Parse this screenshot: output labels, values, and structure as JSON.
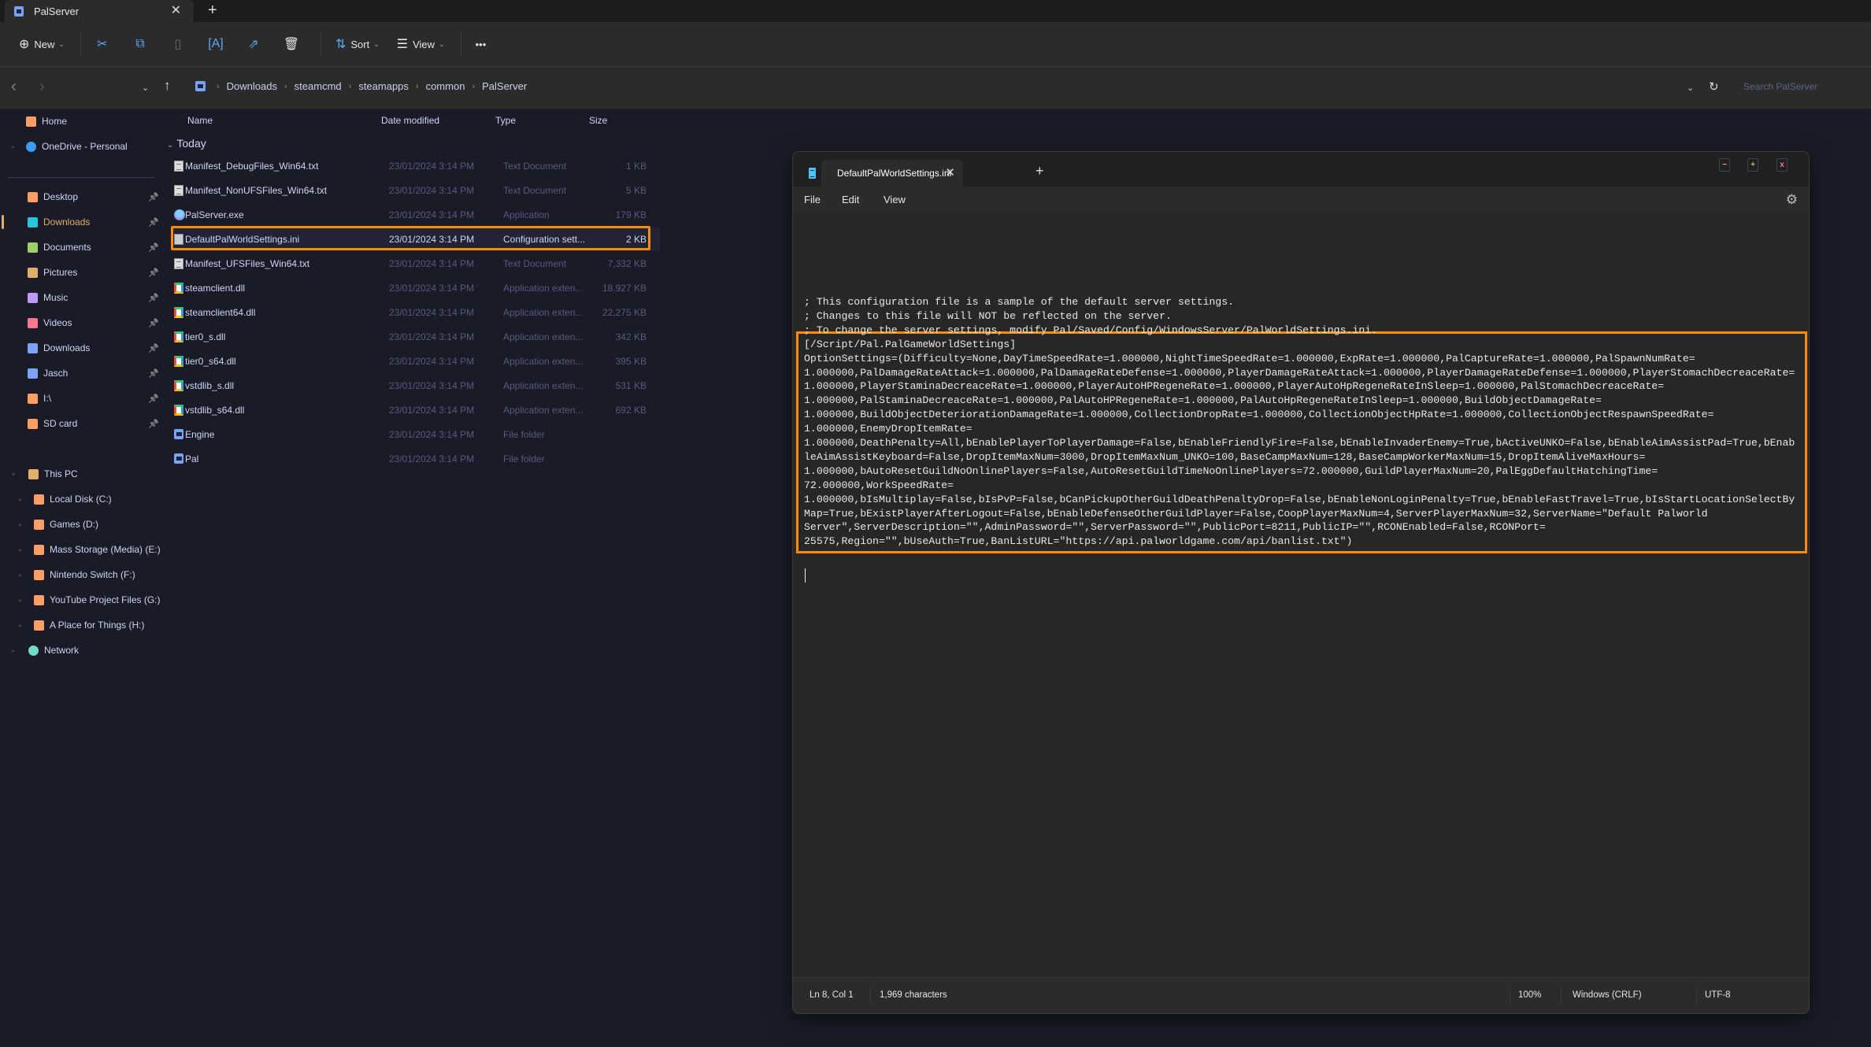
{
  "explorer": {
    "window_tab": {
      "title": "PalServer",
      "close": "✕",
      "new_tab": "+"
    },
    "toolbar": {
      "new_label": "New",
      "sort_label": "Sort",
      "view_label": "View",
      "more_label": "•••",
      "icons": [
        "cut-icon",
        "copy-icon",
        "paste-icon",
        "rename-icon",
        "share-icon",
        "delete-icon"
      ]
    },
    "breadcrumb": [
      "Downloads",
      "steamcmd",
      "steamapps",
      "common",
      "PalServer"
    ],
    "search_placeholder": "Search PalServer",
    "sidebar": {
      "top": [
        {
          "label": "Home",
          "icon": "home-icon",
          "color": "#ff9e64"
        },
        {
          "label": "OneDrive - Personal",
          "icon": "cloud-icon",
          "color": "#3b9cf0"
        }
      ],
      "quick_access": [
        {
          "label": "Desktop",
          "color": "#ff9e64",
          "pinned": true
        },
        {
          "label": "Downloads",
          "color": "#2ac3de",
          "pinned": true,
          "active": true
        },
        {
          "label": "Documents",
          "color": "#9ece6a",
          "pinned": true
        },
        {
          "label": "Pictures",
          "color": "#e0af68",
          "pinned": true
        },
        {
          "label": "Music",
          "color": "#bb9af7",
          "pinned": true
        },
        {
          "label": "Videos",
          "color": "#f7768e",
          "pinned": true
        },
        {
          "label": "Downloads",
          "color": "#7aa2f7",
          "pinned": true
        },
        {
          "label": "Jasch",
          "color": "#7aa2f7",
          "pinned": true
        },
        {
          "label": "I:\\",
          "color": "#ff9e64",
          "pinned": true
        },
        {
          "label": "SD card",
          "color": "#ff9e64",
          "pinned": true
        }
      ],
      "this_pc": {
        "label": "This PC",
        "color": "#e0af68"
      },
      "drives": [
        {
          "label": "Local Disk (C:)"
        },
        {
          "label": "Games (D:)"
        },
        {
          "label": "Mass Storage (Media) (E:)"
        },
        {
          "label": "Nintendo Switch (F:)"
        },
        {
          "label": "YouTube Project Files (G:)"
        },
        {
          "label": "A Place for Things (H:)"
        }
      ],
      "network": {
        "label": "Network",
        "color": "#73daca"
      }
    },
    "columns": {
      "name": "Name",
      "date": "Date modified",
      "type": "Type",
      "size": "Size"
    },
    "group": "Today",
    "files": [
      {
        "name": "Manifest_DebugFiles_Win64.txt",
        "date": "23/01/2024 3:14 PM",
        "type": "Text Document",
        "size": "1 KB",
        "kind": "txt"
      },
      {
        "name": "Manifest_NonUFSFiles_Win64.txt",
        "date": "23/01/2024 3:14 PM",
        "type": "Text Document",
        "size": "5 KB",
        "kind": "txt"
      },
      {
        "name": "PalServer.exe",
        "date": "23/01/2024 3:14 PM",
        "type": "Application",
        "size": "179 KB",
        "kind": "exe"
      },
      {
        "name": "DefaultPalWorldSettings.ini",
        "date": "23/01/2024 3:14 PM",
        "type": "Configuration sett...",
        "size": "2 KB",
        "kind": "ini",
        "selected": true
      },
      {
        "name": "Manifest_UFSFiles_Win64.txt",
        "date": "23/01/2024 3:14 PM",
        "type": "Text Document",
        "size": "7,332 KB",
        "kind": "txt"
      },
      {
        "name": "steamclient.dll",
        "date": "23/01/2024 3:14 PM",
        "type": "Application exten...",
        "size": "18,927 KB",
        "kind": "dll"
      },
      {
        "name": "steamclient64.dll",
        "date": "23/01/2024 3:14 PM",
        "type": "Application exten...",
        "size": "22,275 KB",
        "kind": "dll"
      },
      {
        "name": "tier0_s.dll",
        "date": "23/01/2024 3:14 PM",
        "type": "Application exten...",
        "size": "342 KB",
        "kind": "dll"
      },
      {
        "name": "tier0_s64.dll",
        "date": "23/01/2024 3:14 PM",
        "type": "Application exten...",
        "size": "395 KB",
        "kind": "dll"
      },
      {
        "name": "vstdlib_s.dll",
        "date": "23/01/2024 3:14 PM",
        "type": "Application exten...",
        "size": "531 KB",
        "kind": "dll"
      },
      {
        "name": "vstdlib_s64.dll",
        "date": "23/01/2024 3:14 PM",
        "type": "Application exten...",
        "size": "692 KB",
        "kind": "dll"
      },
      {
        "name": "Engine",
        "date": "23/01/2024 3:14 PM",
        "type": "File folder",
        "size": "",
        "kind": "folder"
      },
      {
        "name": "Pal",
        "date": "23/01/2024 3:14 PM",
        "type": "File folder",
        "size": "",
        "kind": "folder"
      }
    ]
  },
  "notepad": {
    "tab_title": "DefaultPalWorldSettings.ini",
    "tab_close": "✕",
    "new_tab": "+",
    "window_buttons": {
      "minimize": "−",
      "maximize": "+",
      "close": "x"
    },
    "menu": [
      "File",
      "Edit",
      "View"
    ],
    "lines": [
      "; This configuration file is a sample of the default server settings.",
      "; Changes to this file will NOT be reflected on the server.",
      "; To change the server settings, modify Pal/Saved/Config/WindowsServer/PalWorldSettings.ini.",
      "[/Script/Pal.PalGameWorldSettings]",
      "OptionSettings=(Difficulty=None,DayTimeSpeedRate=1.000000,NightTimeSpeedRate=1.000000,ExpRate=1.000000,PalCaptureRate=1.000000,PalSpawnNumRate=",
      "1.000000,PalDamageRateAttack=1.000000,PalDamageRateDefense=1.000000,PlayerDamageRateAttack=1.000000,PlayerDamageRateDefense=1.000000,PlayerStomachDecreaceRate=",
      "1.000000,PlayerStaminaDecreaceRate=1.000000,PlayerAutoHPRegeneRate=1.000000,PlayerAutoHpRegeneRateInSleep=1.000000,PalStomachDecreaceRate=",
      "1.000000,PalStaminaDecreaceRate=1.000000,PalAutoHPRegeneRate=1.000000,PalAutoHpRegeneRateInSleep=1.000000,BuildObjectDamageRate=",
      "1.000000,BuildObjectDeteriorationDamageRate=1.000000,CollectionDropRate=1.000000,CollectionObjectHpRate=1.000000,CollectionObjectRespawnSpeedRate=",
      "1.000000,EnemyDropItemRate=",
      "1.000000,DeathPenalty=All,bEnablePlayerToPlayerDamage=False,bEnableFriendlyFire=False,bEnableInvaderEnemy=True,bActiveUNKO=False,bEnableAimAssistPad=True,bEnab",
      "leAimAssistKeyboard=False,DropItemMaxNum=3000,DropItemMaxNum_UNKO=100,BaseCampMaxNum=128,BaseCampWorkerMaxNum=15,DropItemAliveMaxHours=",
      "1.000000,bAutoResetGuildNoOnlinePlayers=False,AutoResetGuildTimeNoOnlinePlayers=72.000000,GuildPlayerMaxNum=20,PalEggDefaultHatchingTime=",
      "72.000000,WorkSpeedRate=",
      "1.000000,bIsMultiplay=False,bIsPvP=False,bCanPickupOtherGuildDeathPenaltyDrop=False,bEnableNonLoginPenalty=True,bEnableFastTravel=True,bIsStartLocationSelectBy",
      "Map=True,bExistPlayerAfterLogout=False,bEnableDefenseOtherGuildPlayer=False,CoopPlayerMaxNum=4,ServerPlayerMaxNum=32,ServerName=\"Default Palworld",
      "Server\",ServerDescription=\"\",AdminPassword=\"\",ServerPassword=\"\",PublicPort=8211,PublicIP=\"\",RCONEnabled=False,RCONPort=",
      "25575,Region=\"\",bUseAuth=True,BanListURL=\"https://api.palworldgame.com/api/banlist.txt\")"
    ],
    "status": {
      "position": "Ln 8, Col 1",
      "characters": "1,969 characters",
      "zoom": "100%",
      "line_endings": "Windows (CRLF)",
      "encoding": "UTF-8"
    }
  },
  "highlight_color": "#ff8c00"
}
